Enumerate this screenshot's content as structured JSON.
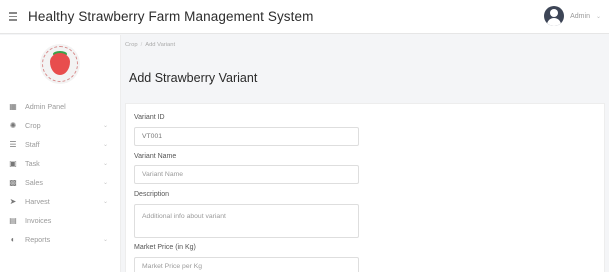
{
  "header": {
    "menu_icon": "hamburger-icon",
    "title": "Healthy Strawberry Farm Management System",
    "user_name": "Admin",
    "user_icon": "user-avatar-icon"
  },
  "sidebar": {
    "logo_icon": "strawberry-logo-icon",
    "items": [
      {
        "label": "Admin Panel",
        "icon": "grid-icon",
        "has_caret": false
      },
      {
        "label": "Crop",
        "icon": "crop-icon",
        "has_caret": true
      },
      {
        "label": "Staff",
        "icon": "staff-icon",
        "has_caret": true
      },
      {
        "label": "Task",
        "icon": "task-icon",
        "has_caret": true
      },
      {
        "label": "Sales",
        "icon": "sales-icon",
        "has_caret": true
      },
      {
        "label": "Harvest",
        "icon": "harvest-icon",
        "has_caret": true
      },
      {
        "label": "Invoices",
        "icon": "invoice-icon",
        "has_caret": false
      },
      {
        "label": "Reports",
        "icon": "reports-icon",
        "has_caret": true
      }
    ]
  },
  "breadcrumb": {
    "parent": "Crop",
    "separator": "/",
    "current": "Add Variant"
  },
  "page": {
    "title": "Add Strawberry Variant"
  },
  "form": {
    "variant_id": {
      "label": "Variant ID",
      "value": "VT001"
    },
    "variant_name": {
      "label": "Variant Name",
      "placeholder": "Variant Name"
    },
    "description": {
      "label": "Description",
      "placeholder": "Additional info about variant"
    },
    "market_price": {
      "label": "Market Price (in Kg)",
      "placeholder": "Market Price per Kg"
    }
  }
}
